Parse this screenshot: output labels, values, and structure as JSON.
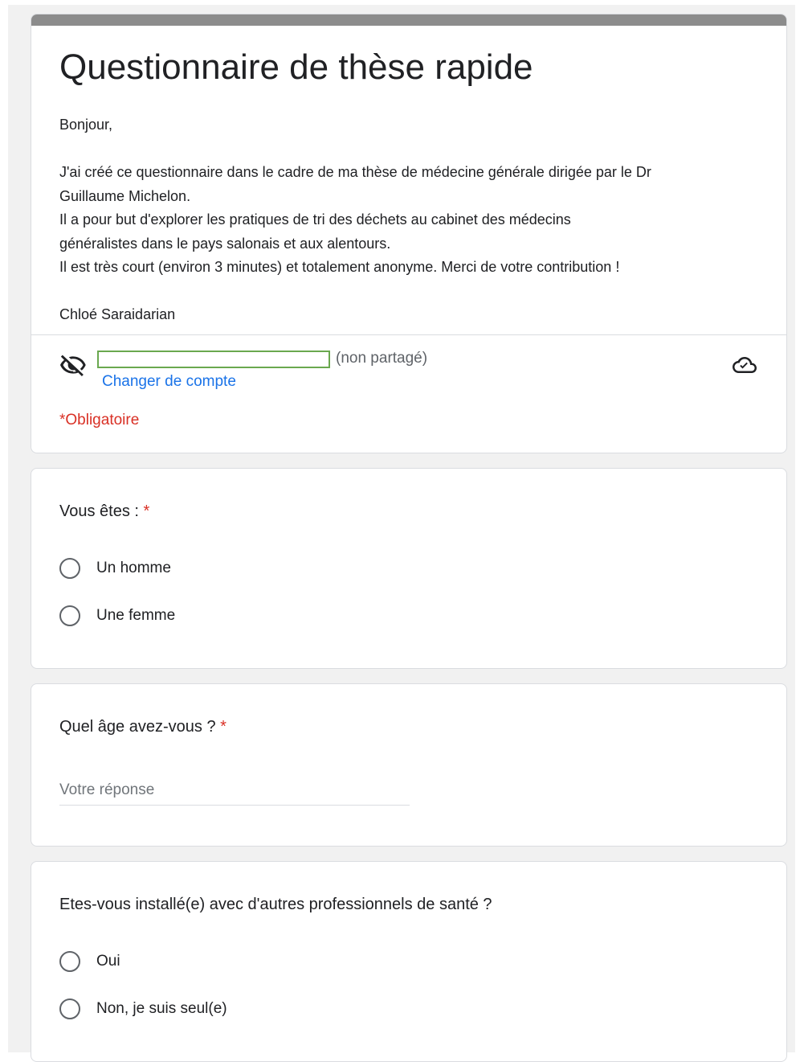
{
  "form": {
    "title": "Questionnaire de thèse rapide",
    "description": [
      "Bonjour,",
      "",
      "J'ai créé ce questionnaire dans le cadre de ma thèse de médecine générale dirigée par le Dr",
      "Guillaume Michelon.",
      "Il a pour but d'explorer les pratiques de tri des déchets au cabinet des médecins",
      "généralistes dans le pays salonais et aux alentours.",
      "Il est très court (environ 3 minutes) et totalement anonyme. Merci de votre contribution !",
      "",
      "Chloé Saraidarian"
    ],
    "header_bar_color": "#8c8c8c"
  },
  "account": {
    "not_shared_label": "(non partagé)",
    "switch_account_label": "Changer de compte",
    "redaction_box_color": "#6aa84f",
    "icons": {
      "visibility": "eye-off-icon",
      "save_status": "cloud-check-icon"
    }
  },
  "required_note": "*Obligatoire",
  "questions": [
    {
      "title": "Vous êtes :",
      "required_mark": "*",
      "type": "radio",
      "options": [
        "Un homme",
        "Une femme"
      ]
    },
    {
      "title": "Quel âge avez-vous ?",
      "required_mark": "*",
      "type": "text",
      "placeholder": "Votre réponse"
    },
    {
      "title": "Etes-vous installé(e) avec d'autres professionnels de santé ?",
      "required_mark": "",
      "type": "radio",
      "options": [
        "Oui",
        "Non, je suis seul(e)"
      ]
    }
  ],
  "colors": {
    "required": "#d93025",
    "link": "#1a73e8",
    "page_background": "#f1f1f1"
  }
}
